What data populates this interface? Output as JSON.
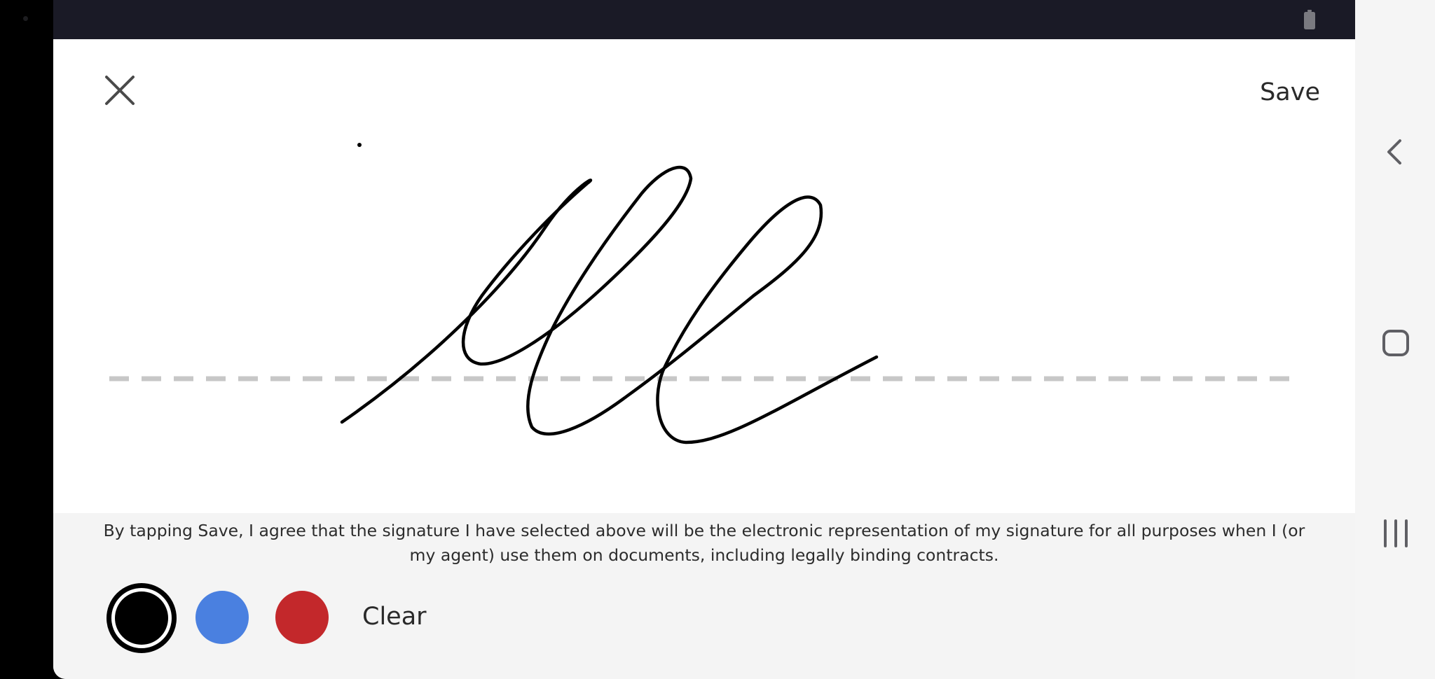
{
  "header": {
    "close_icon": "close-icon",
    "save_label": "Save"
  },
  "signature": {
    "stroke_color": "#000000",
    "baseline_color": "#c7c7c7"
  },
  "footer": {
    "disclaimer": "By tapping Save, I agree that the signature I have selected above will be the electronic representation of my signature for all purposes when I (or my agent) use them on documents, including legally binding contracts.",
    "colors": [
      {
        "name": "black",
        "hex": "#000000",
        "selected": true
      },
      {
        "name": "blue",
        "hex": "#4a80e0",
        "selected": false
      },
      {
        "name": "red",
        "hex": "#c3282b",
        "selected": false
      }
    ],
    "clear_label": "Clear"
  },
  "status_bar": {
    "battery_icon": "battery-icon"
  },
  "nav_bar": {
    "back_icon": "back-chevron-icon",
    "home_icon": "home-square-icon",
    "recents_icon": "recents-icon"
  }
}
